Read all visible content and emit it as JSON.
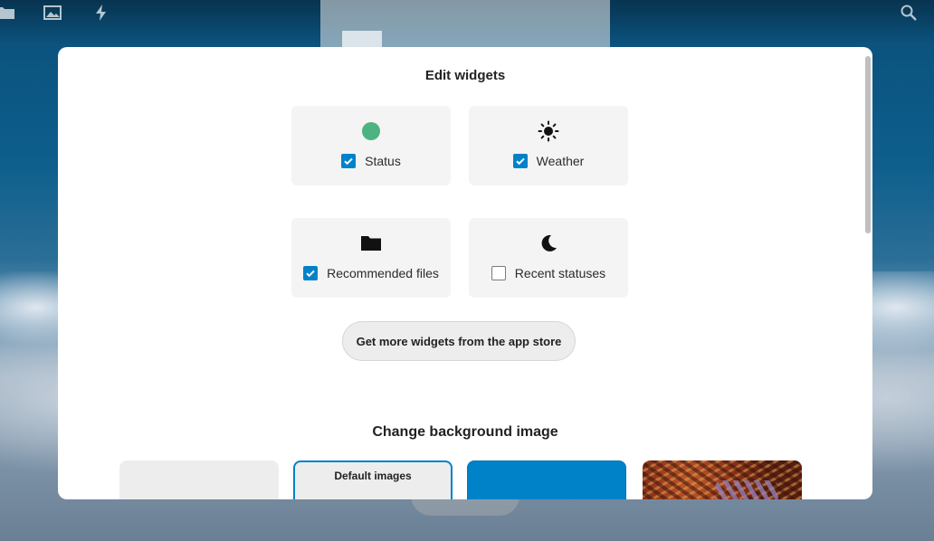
{
  "modal": {
    "widgets_title": "Edit widgets",
    "background_title": "Change background image",
    "store_button_label": "Get more widgets from the app store"
  },
  "widgets": [
    {
      "label": "Status",
      "icon": "status-dot-icon",
      "checked": true,
      "color": "#4db380"
    },
    {
      "label": "Weather",
      "icon": "sun-icon",
      "checked": true
    },
    {
      "label": "Recommended files",
      "icon": "folder-icon",
      "checked": true
    },
    {
      "label": "Recent statuses",
      "icon": "moon-icon",
      "checked": false
    }
  ],
  "backgrounds": [
    {
      "label": "",
      "kind": "plain"
    },
    {
      "label": "Default images",
      "kind": "default",
      "selected": true
    },
    {
      "label": "",
      "kind": "color",
      "color": "#0082c9"
    },
    {
      "label": "",
      "kind": "photo"
    }
  ],
  "colors": {
    "accent": "#0082c9",
    "status_green": "#4db380"
  }
}
